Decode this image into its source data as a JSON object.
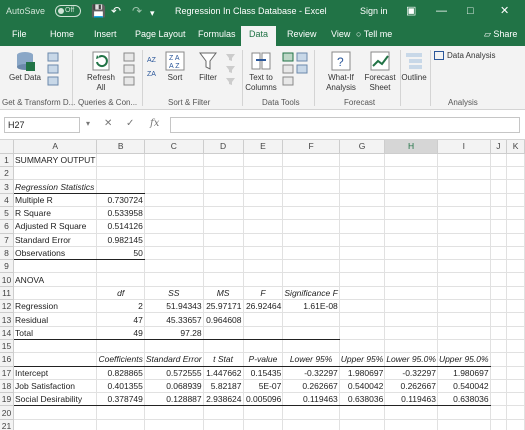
{
  "titlebar": {
    "autosave_label": "AutoSave",
    "autosave_state": "Off",
    "doc_title": "Regression In Class Database  -  Excel",
    "signin": "Sign in"
  },
  "tabs": [
    "File",
    "Home",
    "Insert",
    "Page Layout",
    "Formulas",
    "Data",
    "Review",
    "View"
  ],
  "active_tab": "Data",
  "tellme": "Tell me",
  "share": "Share",
  "ribbon": {
    "get_data": "Get Data",
    "refresh_all": "Refresh All",
    "sort": "Sort",
    "filter": "Filter",
    "text_to_columns": "Text to Columns",
    "what_if": "What-If Analysis",
    "forecast_sheet": "Forecast Sheet",
    "outline": "Outline",
    "data_analysis": "Data Analysis",
    "groups": [
      "Get & Transform D...",
      "Queries & Con...",
      "Sort & Filter",
      "Data Tools",
      "Forecast",
      "Analysis"
    ]
  },
  "formula_bar": {
    "name_box": "H27",
    "fx": "fx",
    "value": ""
  },
  "columns": [
    "A",
    "B",
    "C",
    "D",
    "E",
    "F",
    "G",
    "H",
    "I",
    "J",
    "K"
  ],
  "selected_column": "H",
  "rows": [
    [
      "SUMMARY OUTPUT",
      "",
      "",
      "",
      "",
      "",
      "",
      "",
      "",
      "",
      ""
    ],
    [
      "",
      "",
      "",
      "",
      "",
      "",
      "",
      "",
      "",
      "",
      ""
    ],
    [
      "Regression Statistics",
      "",
      "",
      "",
      "",
      "",
      "",
      "",
      "",
      "",
      ""
    ],
    [
      "Multiple R",
      "0.730724",
      "",
      "",
      "",
      "",
      "",
      "",
      "",
      "",
      ""
    ],
    [
      "R Square",
      "0.533958",
      "",
      "",
      "",
      "",
      "",
      "",
      "",
      "",
      ""
    ],
    [
      "Adjusted R Square",
      "0.514126",
      "",
      "",
      "",
      "",
      "",
      "",
      "",
      "",
      ""
    ],
    [
      "Standard Error",
      "0.982145",
      "",
      "",
      "",
      "",
      "",
      "",
      "",
      "",
      ""
    ],
    [
      "Observations",
      "50",
      "",
      "",
      "",
      "",
      "",
      "",
      "",
      "",
      ""
    ],
    [
      "",
      "",
      "",
      "",
      "",
      "",
      "",
      "",
      "",
      "",
      ""
    ],
    [
      "ANOVA",
      "",
      "",
      "",
      "",
      "",
      "",
      "",
      "",
      "",
      ""
    ],
    [
      "",
      "df",
      "SS",
      "MS",
      "F",
      "Significance F",
      "",
      "",
      "",
      "",
      ""
    ],
    [
      "Regression",
      "2",
      "51.94343",
      "25.97171",
      "26.92464",
      "1.61E-08",
      "",
      "",
      "",
      "",
      ""
    ],
    [
      "Residual",
      "47",
      "45.33657",
      "0.964608",
      "",
      "",
      "",
      "",
      "",
      "",
      ""
    ],
    [
      "Total",
      "49",
      "97.28",
      "",
      "",
      "",
      "",
      "",
      "",
      "",
      ""
    ],
    [
      "",
      "",
      "",
      "",
      "",
      "",
      "",
      "",
      "",
      "",
      ""
    ],
    [
      "",
      "Coefficients",
      "Standard Error",
      "t Stat",
      "P-value",
      "Lower 95%",
      "Upper 95%",
      "Lower 95.0%",
      "Upper 95.0%",
      "",
      ""
    ],
    [
      "Intercept",
      "0.828865",
      "0.572555",
      "1.447662",
      "0.15435",
      "-0.32297",
      "1.980697",
      "-0.32297",
      "1.980697",
      "",
      ""
    ],
    [
      "Job Satisfaction",
      "0.401355",
      "0.068939",
      "5.82187",
      "5E-07",
      "0.262667",
      "0.540042",
      "0.262667",
      "0.540042",
      "",
      ""
    ],
    [
      "Social Desirability",
      "0.378749",
      "0.128887",
      "2.938624",
      "0.005096",
      "0.119463",
      "0.638036",
      "0.119463",
      "0.638036",
      "",
      ""
    ],
    [
      "",
      "",
      "",
      "",
      "",
      "",
      "",
      "",
      "",
      "",
      ""
    ],
    [
      "",
      "",
      "",
      "",
      "",
      "",
      "",
      "",
      "",
      "",
      ""
    ]
  ]
}
